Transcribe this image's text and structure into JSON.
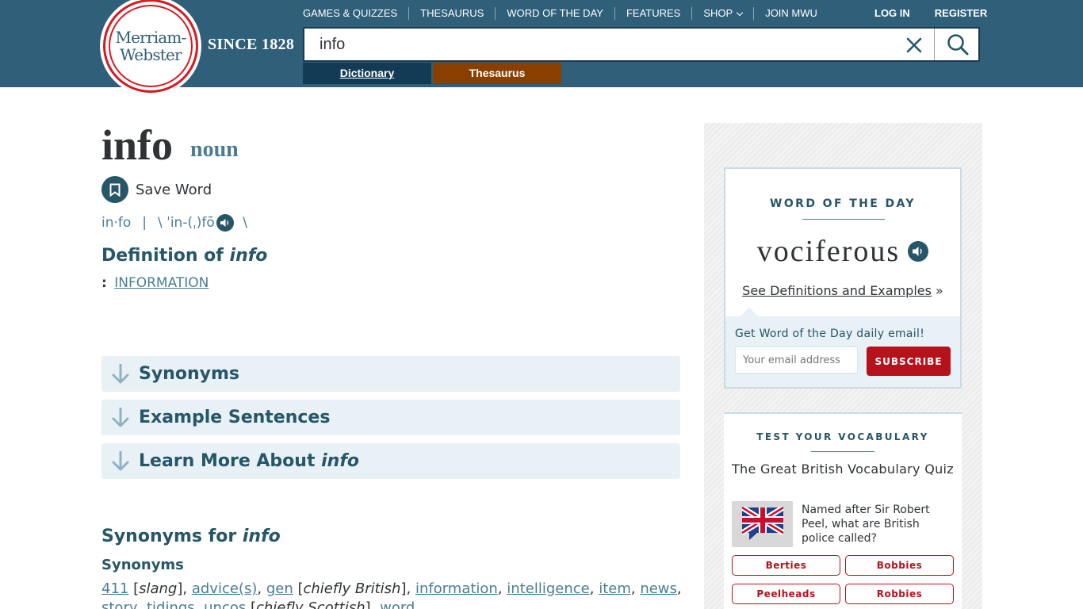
{
  "header": {
    "logo_line1": "Merriam-",
    "logo_line2": "Webster",
    "since": "SINCE 1828",
    "nav": [
      "GAMES & QUIZZES",
      "THESAURUS",
      "WORD OF THE DAY",
      "FEATURES",
      "SHOP",
      "JOIN MWU"
    ],
    "login": "LOG IN",
    "register": "REGISTER",
    "search_value": "info",
    "tab_dictionary": "Dictionary",
    "tab_thesaurus": "Thesaurus"
  },
  "entry": {
    "headword": "info",
    "pos": "noun",
    "save_label": "Save Word",
    "syllables": "in·fo",
    "separator": "|",
    "pron_open": "\\ ˈin-(ˌ)fō",
    "pron_close": " \\",
    "definition_prefix": "Definition of ",
    "definition_word": "info",
    "definition_colon": ":",
    "definition_link": "information"
  },
  "accordions": {
    "synonyms": "Synonyms",
    "examples": "Example Sentences",
    "learn_more_prefix": "Learn More About ",
    "learn_more_word": "info"
  },
  "synonyms_section": {
    "heading_prefix": "Synonyms for ",
    "heading_word": "info",
    "subheading": "Synonyms",
    "items": [
      {
        "word": "411",
        "note": "slang"
      },
      {
        "word": "advice(s)"
      },
      {
        "word": "gen",
        "note": "chiefly British"
      },
      {
        "word": "information"
      },
      {
        "word": "intelligence"
      },
      {
        "word": "item"
      },
      {
        "word": "news"
      },
      {
        "word": "story"
      },
      {
        "word": "tidings"
      },
      {
        "word": "uncos",
        "note": "chiefly Scottish"
      },
      {
        "word": "word"
      }
    ]
  },
  "word_of_day": {
    "kicker": "WORD OF THE DAY",
    "word": "vociferous",
    "see_link": "See Definitions and Examples",
    "see_suffix": " »",
    "email_prompt": "Get Word of the Day daily email!",
    "email_placeholder": "Your email address",
    "subscribe": "SUBSCRIBE"
  },
  "vocab_quiz": {
    "kicker": "TEST YOUR VOCABULARY",
    "title": "The Great British Vocabulary Quiz",
    "question": "Named after Sir Robert Peel, what are British police called?",
    "options": [
      "Berties",
      "Bobbies",
      "Peelheads",
      "Robbies"
    ]
  },
  "colors": {
    "header_bg": "#305f7a",
    "dictionary_tab": "#143b55",
    "thesaurus_tab": "#8a3e00",
    "accent_red": "#b5121b",
    "link_blue": "#4a7d95"
  }
}
